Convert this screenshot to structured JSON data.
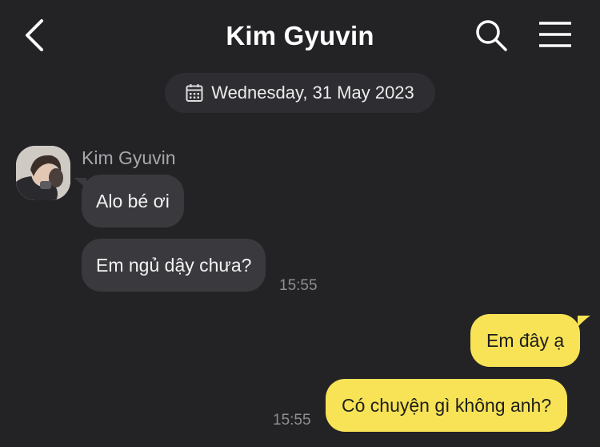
{
  "header": {
    "title": "Kim Gyuvin"
  },
  "date_separator": "Wednesday, 31 May 2023",
  "messages": {
    "sender_name": "Kim Gyuvin",
    "m1": "Alo bé ơi",
    "m2": "Em ngủ dậy chưa?",
    "m2_time": "15:55",
    "m3": "Em đây ạ",
    "m4": "Có chuyện gì không anh?",
    "m4_time": "15:55"
  },
  "colors": {
    "background": "#232326",
    "incoming_bubble": "#3a3a3e",
    "outgoing_bubble": "#f7e355"
  },
  "icons": {
    "back": "chevron-left-icon",
    "search": "search-icon",
    "menu": "hamburger-menu-icon",
    "date": "calendar-icon"
  }
}
